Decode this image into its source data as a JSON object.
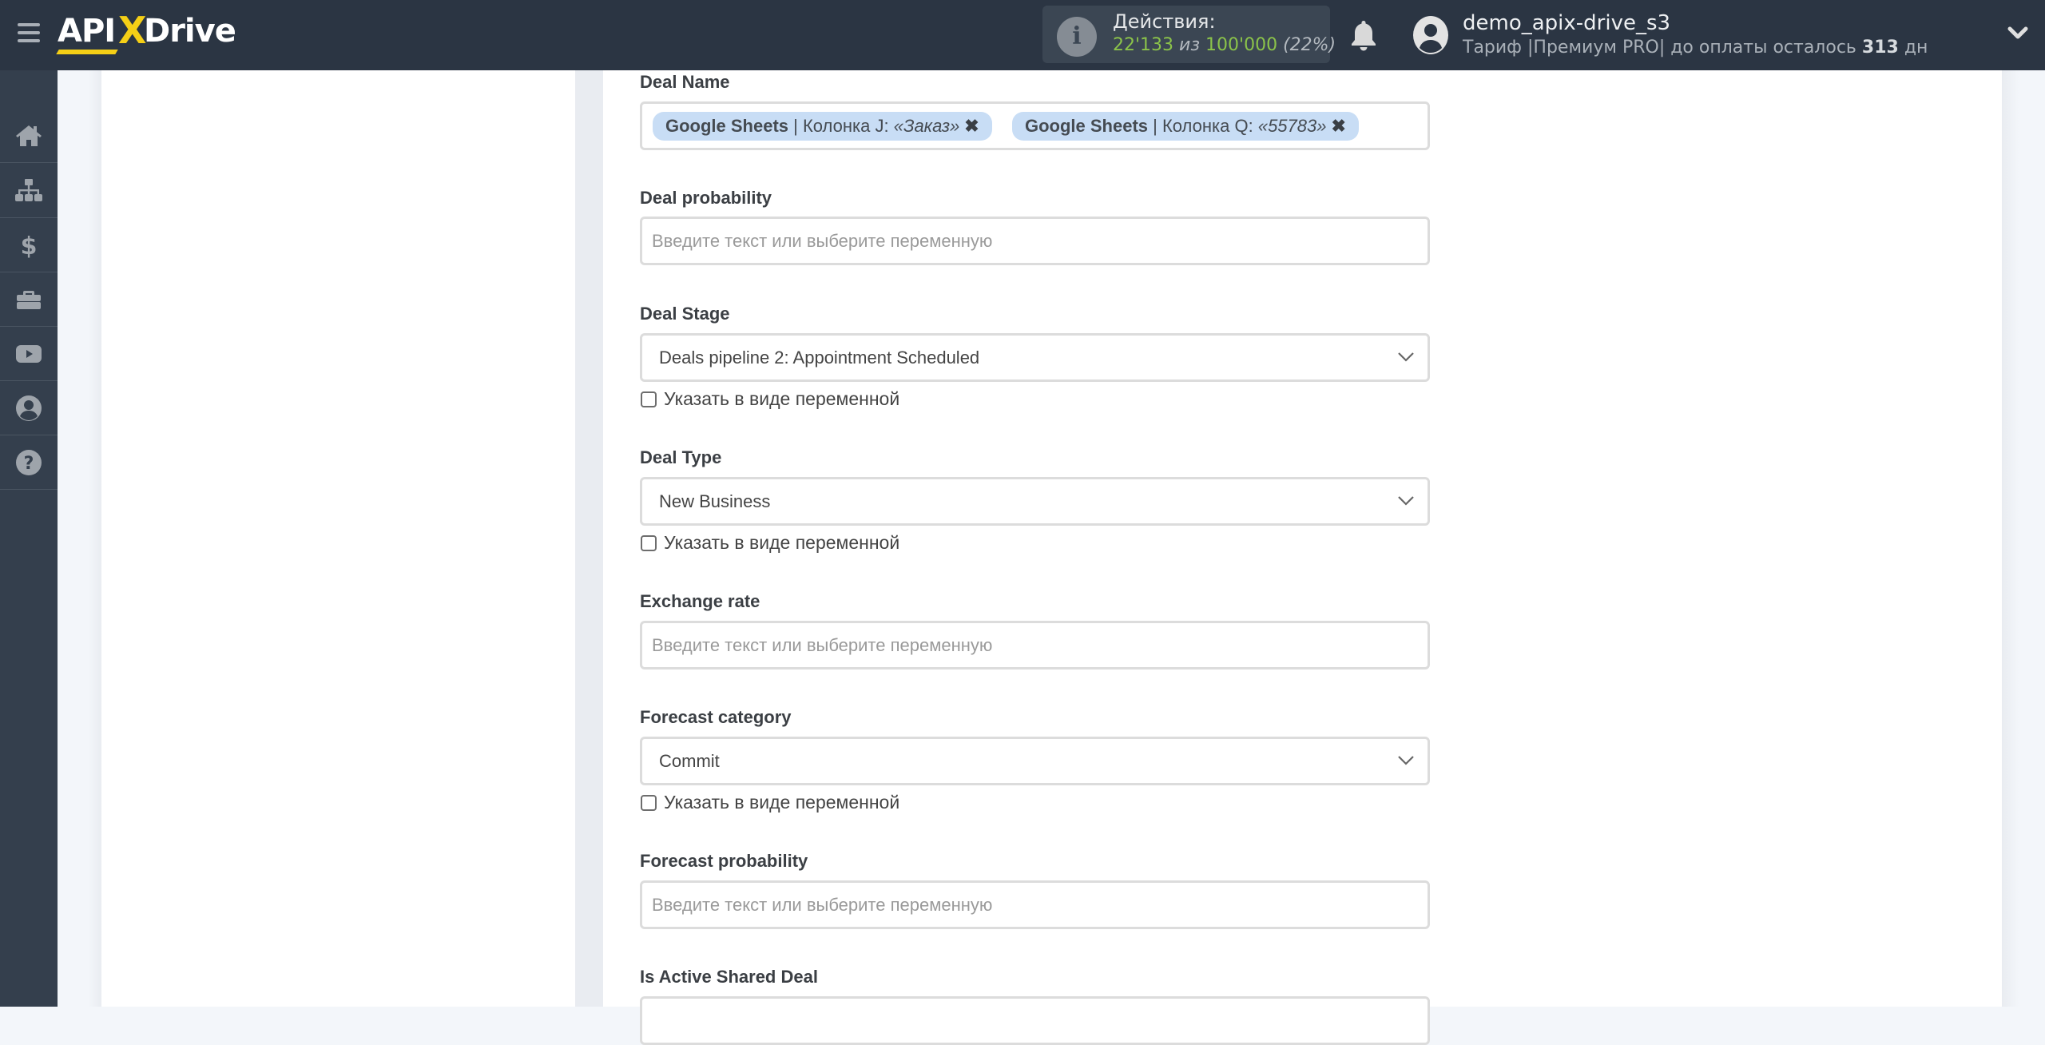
{
  "header": {
    "logo": {
      "api": "API",
      "x": "X",
      "drive": "Drive"
    },
    "actions": {
      "title": "Действия:",
      "used": "22'133",
      "of": "из",
      "total": "100'000",
      "percent": "(22%)"
    },
    "user": {
      "name": "demo_apix-drive_s3",
      "plan_prefix": "Тариф |Премиум PRO| до оплаты осталось",
      "days_left": "313",
      "days_suffix": "дн"
    }
  },
  "sidebar": {
    "items": [
      {
        "name": "home",
        "icon": "home-icon"
      },
      {
        "name": "connections",
        "icon": "sitemap-icon"
      },
      {
        "name": "billing",
        "icon": "dollar-icon"
      },
      {
        "name": "services",
        "icon": "briefcase-icon"
      },
      {
        "name": "video",
        "icon": "youtube-icon"
      },
      {
        "name": "account",
        "icon": "user-circle-icon"
      },
      {
        "name": "help",
        "icon": "question-circle-icon"
      }
    ]
  },
  "form": {
    "placeholder": "Введите текст или выберите переменную",
    "as_variable_label": "Указать в виде переменной",
    "fields": {
      "deal_name": {
        "label": "Deal Name",
        "chips": [
          {
            "source": "Google Sheets",
            "column": " | Колонка J: ",
            "value": "«Заказ»",
            "remove": "✖"
          },
          {
            "source": "Google Sheets",
            "column": " | Колонка Q: ",
            "value": "«55783»",
            "remove": "✖"
          }
        ]
      },
      "deal_probability": {
        "label": "Deal probability"
      },
      "deal_stage": {
        "label": "Deal Stage",
        "value": "Deals pipeline 2: Appointment Scheduled",
        "as_variable": false
      },
      "deal_type": {
        "label": "Deal Type",
        "value": "New Business",
        "as_variable": false
      },
      "exchange_rate": {
        "label": "Exchange rate"
      },
      "forecast_category": {
        "label": "Forecast category",
        "value": "Commit",
        "as_variable": false
      },
      "forecast_probability": {
        "label": "Forecast probability"
      },
      "is_active_shared_deal": {
        "label": "Is Active Shared Deal"
      }
    }
  },
  "colors": {
    "header_bg": "#2b3543",
    "sidebar_bg": "#343f4d",
    "accent_yellow": "#f5cf16",
    "stats_green": "#8bc34a",
    "chip_bg": "#c8ddf5"
  }
}
